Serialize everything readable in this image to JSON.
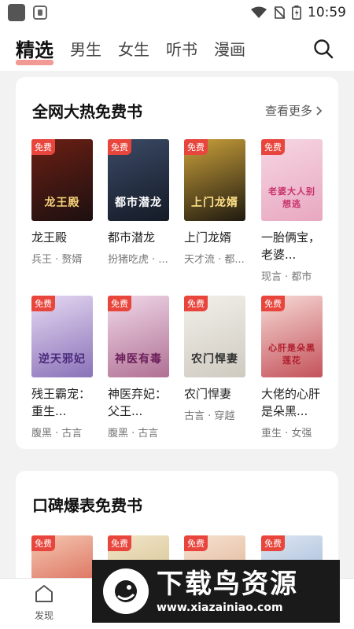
{
  "status_bar": {
    "time": "10:59"
  },
  "header": {
    "tabs": [
      {
        "label": "精选",
        "active": true
      },
      {
        "label": "男生"
      },
      {
        "label": "女生"
      },
      {
        "label": "听书"
      },
      {
        "label": "漫画"
      }
    ]
  },
  "section1": {
    "title": "全网大热免费书",
    "more_label": "查看更多",
    "books": [
      {
        "badge": "免费",
        "cover_text": "龙王殿",
        "title": "龙王殿",
        "tags": "兵王 · 赘婿",
        "cover_colors": [
          "#6b1f14",
          "#1c1010"
        ]
      },
      {
        "badge": "免费",
        "cover_text": "都市潜龙",
        "title": "都市潜龙",
        "tags": "扮猪吃虎 · ...",
        "cover_colors": [
          "#3b4a66",
          "#141a26"
        ]
      },
      {
        "badge": "免费",
        "cover_text": "上门龙婿",
        "title": "上门龙婿",
        "tags": "天才流 · 都...",
        "cover_colors": [
          "#caa03a",
          "#1f1a10"
        ]
      },
      {
        "badge": "免费",
        "cover_text": "老婆大人别想逃",
        "title": "一胎俩宝，老婆...",
        "tags": "现言 · 都市",
        "cover_colors": [
          "#f6d6e2",
          "#e8a8c0"
        ]
      },
      {
        "badge": "免费",
        "cover_text": "逆天邪妃",
        "title": "残王霸宠：重生...",
        "tags": "腹黑 · 古言",
        "cover_colors": [
          "#e6d8f2",
          "#8a72b8"
        ]
      },
      {
        "badge": "免费",
        "cover_text": "神医有毒",
        "title": "神医弃妃：父王...",
        "tags": "腹黑 · 古言",
        "cover_colors": [
          "#f0d8e8",
          "#b07094"
        ]
      },
      {
        "badge": "免费",
        "cover_text": "农门悍妻",
        "title": "农门悍妻",
        "tags": "古言 · 穿越",
        "cover_colors": [
          "#f2f0ea",
          "#cfcac0"
        ]
      },
      {
        "badge": "免费",
        "cover_text": "心肝是朵黑莲花",
        "title": "大佬的心肝是朵黑...",
        "tags": "重生 · 女强",
        "cover_colors": [
          "#f6dad6",
          "#c4525a"
        ]
      }
    ]
  },
  "section2": {
    "title": "口碑爆表免费书",
    "books": [
      {
        "badge": "免费",
        "cover_colors": [
          "#f4c7b0",
          "#d14a3a"
        ]
      },
      {
        "badge": "免费",
        "cover_colors": [
          "#f2e6c8",
          "#c8b27a"
        ]
      },
      {
        "badge": "免费",
        "cover_colors": [
          "#f6e2d2",
          "#d8a07a"
        ]
      },
      {
        "badge": "免费",
        "cover_colors": [
          "#dde6f2",
          "#8aa6cc"
        ]
      }
    ]
  },
  "bottom_nav": {
    "discover_label": "发现"
  },
  "watermark": {
    "title": "下载鸟资源",
    "url": "www.xiazainiao.com"
  }
}
